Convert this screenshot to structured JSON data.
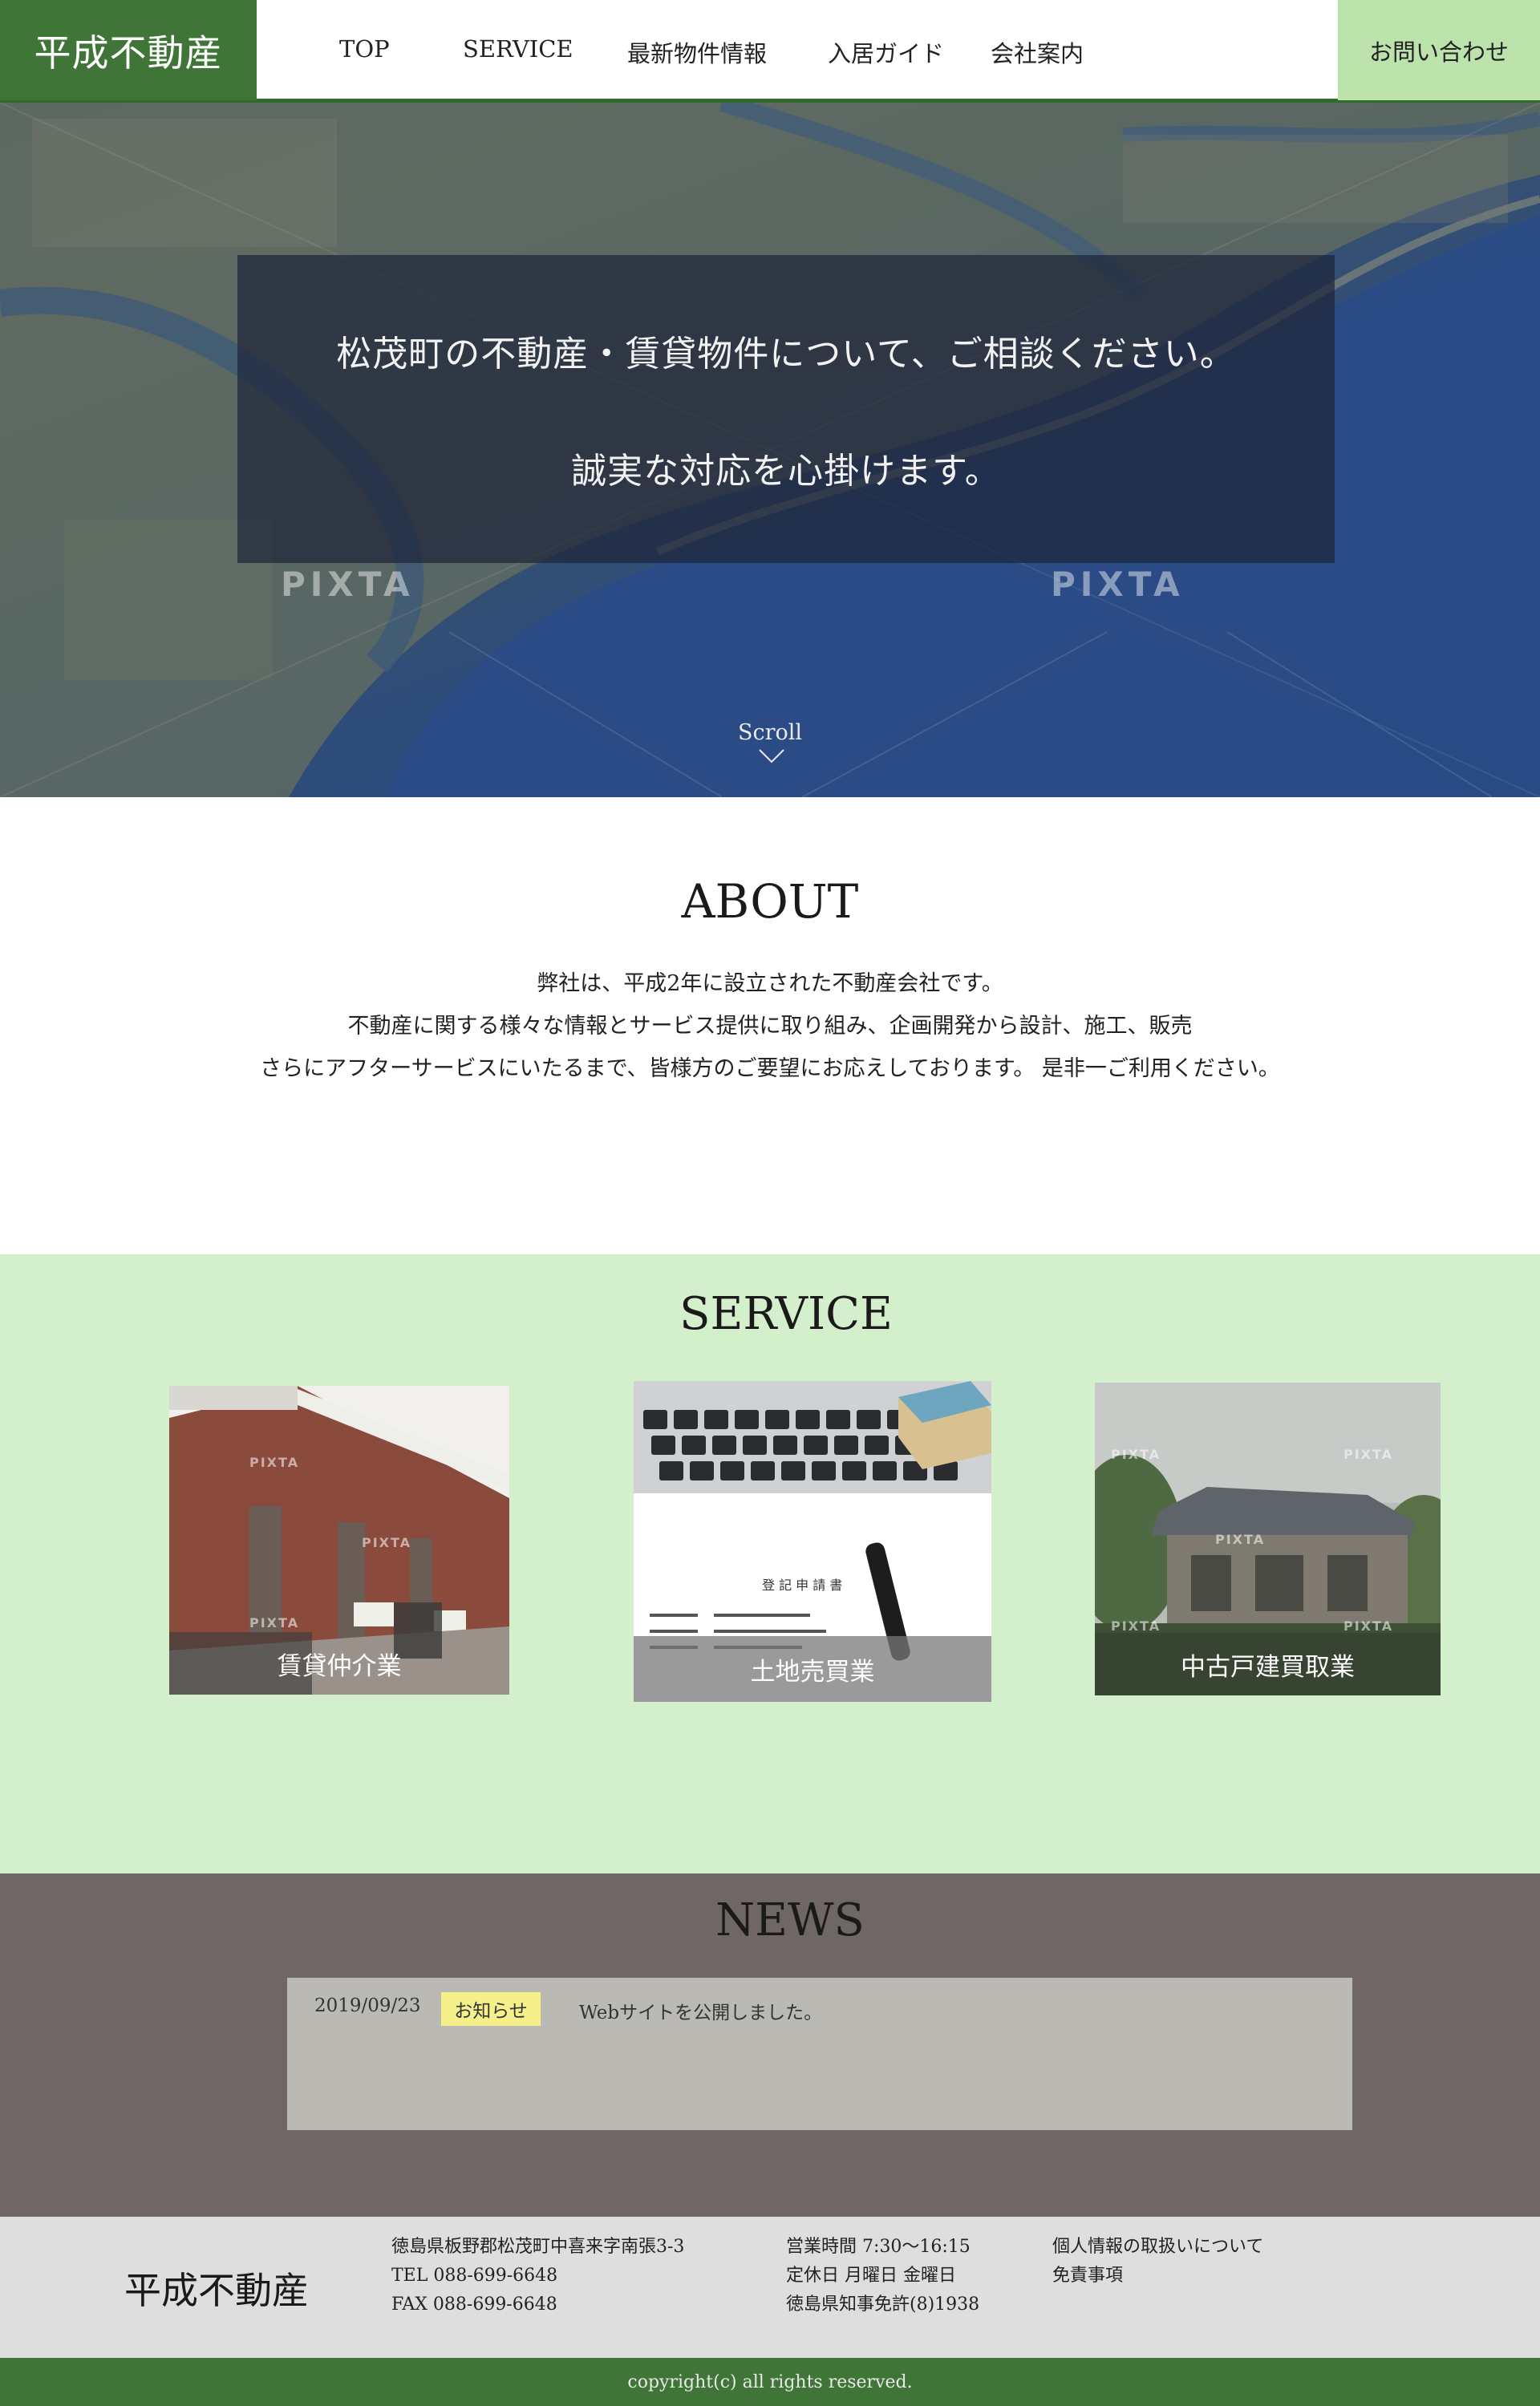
{
  "header": {
    "logo": "平成不動産",
    "nav": [
      {
        "label": "TOP"
      },
      {
        "label": "SERVICE"
      },
      {
        "label": "最新物件情報"
      },
      {
        "label": "入居ガイド"
      },
      {
        "label": "会社案内"
      }
    ],
    "contact": "お問い合わせ"
  },
  "hero": {
    "line1": "松茂町の不動産・賃貸物件について、ご相談ください。",
    "line2": "誠実な対応を心掛けます。",
    "watermark": "PIXTA",
    "scroll": "Scroll"
  },
  "about": {
    "title": "ABOUT",
    "lines": [
      "弊社は、平成2年に設立された不動産会社です。",
      "不動産に関する様々な情報とサービス提供に取り組み、企画開発から設計、施工、販売",
      "さらにアフターサービスにいたるまで、皆様方のご要望にお応えしております。 是非一ご利用ください。"
    ]
  },
  "service": {
    "title": "SERVICE",
    "cards": [
      {
        "label": "賃貸仲介業"
      },
      {
        "label": "土地売買業"
      },
      {
        "label": "中古戸建買取業"
      }
    ],
    "photo_watermark": "PIXTA",
    "document_text": "登 記 申 請 書"
  },
  "news": {
    "title": "NEWS",
    "items": [
      {
        "date": "2019/09/23",
        "tag": "お知らせ",
        "text": "Webサイトを公開しました。"
      }
    ],
    "badge_color": "#f5f08a"
  },
  "footer": {
    "logo": "平成不動産",
    "address": "徳島県板野郡松茂町中喜来字南張3-3",
    "tel": "TEL 088-699-6648",
    "fax": "FAX 088-699-6648",
    "hours": "営業時間 7:30〜16:15",
    "holiday": "定休日 月曜日 金曜日",
    "license": "徳島県知事免許(8)1938",
    "links": [
      "個人情報の取扱いについて",
      "免責事項"
    ],
    "copyright": "copyright(c) all rights reserved."
  },
  "colors": {
    "brand_green": "#3f7536",
    "contact_bg": "#bde3ad",
    "service_bg": "#d3efcb",
    "news_bg": "#6f6666",
    "footer_bg": "#dedede"
  }
}
